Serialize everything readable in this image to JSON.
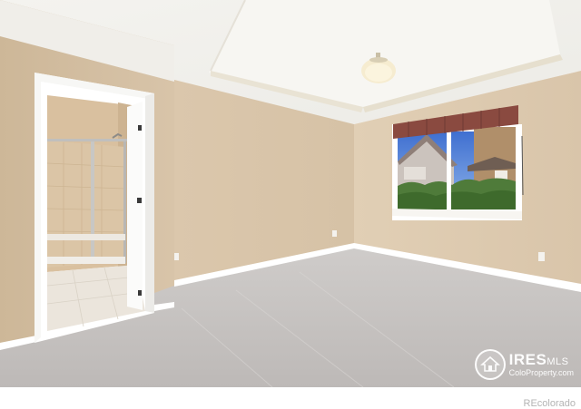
{
  "photo": {
    "subject": "Empty carpeted bedroom with open doorway to a bathroom with glass shower and a window overlooking a neighboring house",
    "colors": {
      "wall": "#d8c4a9",
      "ceiling": "#f2f0ea",
      "carpet": "#c9c6c4",
      "trim": "#ffffff",
      "valance": "#8a4a40",
      "sky": "#4e7fd6",
      "foliage": "#4f7b3a"
    }
  },
  "watermark": {
    "brand": "IRES",
    "brand_suffix": "MLS",
    "url": "ColoProperty.com",
    "icon": "house-seal-icon"
  },
  "credit": "REcolorado"
}
